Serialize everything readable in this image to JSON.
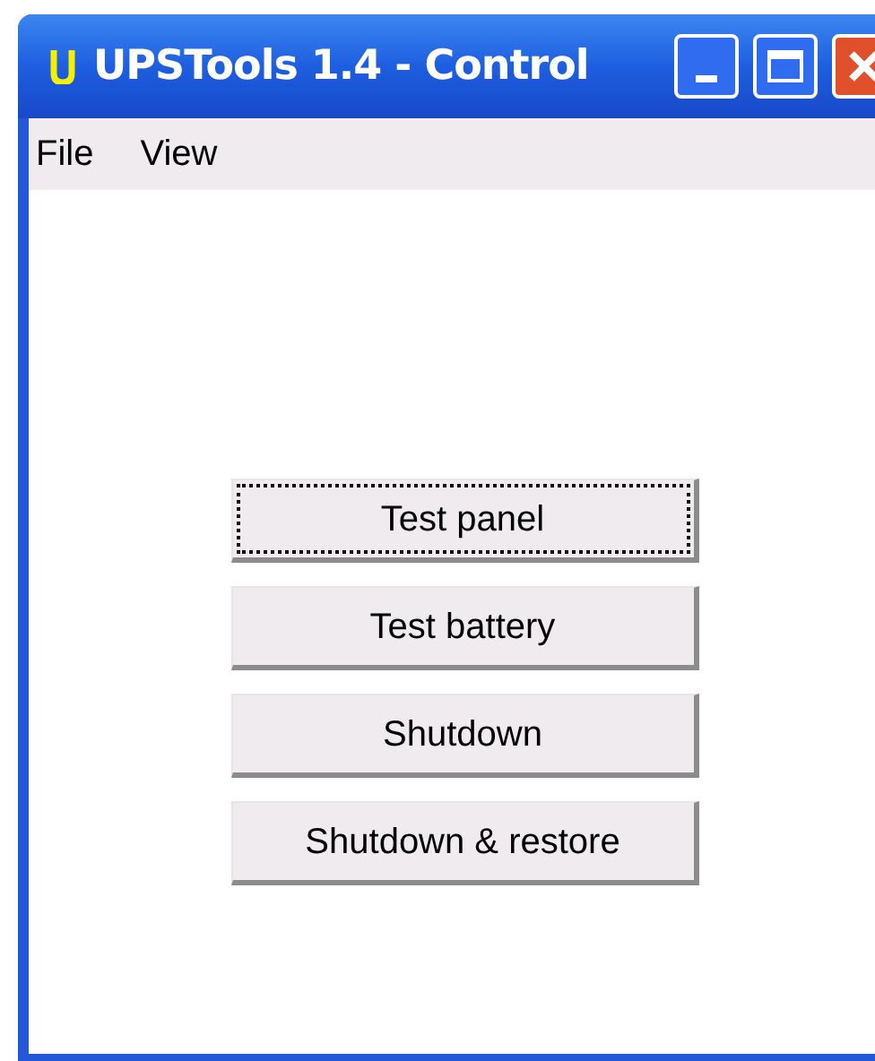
{
  "window": {
    "title": "UPSTools 1.4 - Control"
  },
  "menu": [
    "File",
    "View"
  ],
  "buttons": [
    {
      "label": "Test panel",
      "focused": true
    },
    {
      "label": "Test battery",
      "focused": false
    },
    {
      "label": "Shutdown",
      "focused": false
    },
    {
      "label": "Shutdown & restore",
      "focused": false
    }
  ]
}
